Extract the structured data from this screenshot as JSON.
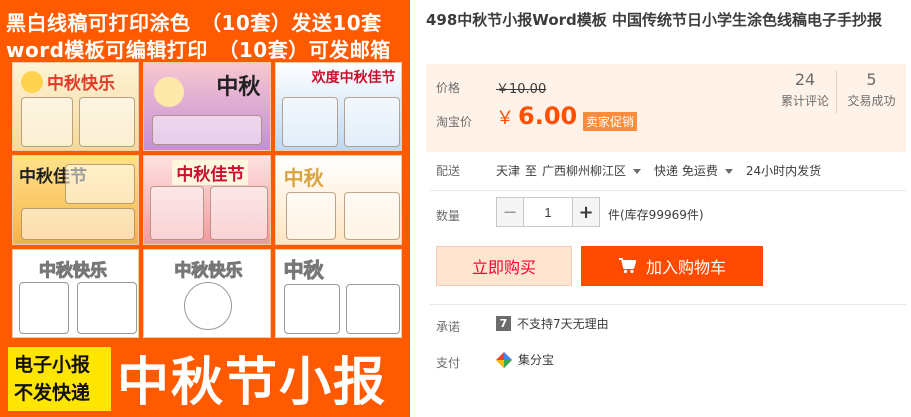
{
  "image": {
    "banner_line_1": "黑白线稿可打印涂色　（10套）发送10套",
    "banner_line_2": "word模板可编辑打印　（10套）可发邮箱",
    "badge_line_1": "电子小报",
    "badge_line_2": "不发快递",
    "big_title": "中秋节小报",
    "thumb_titles": [
      "中秋快乐",
      "中秋",
      "欢度中秋佳节",
      "中秋佳节",
      "中秋佳节",
      "中秋",
      "中秋快乐",
      "中秋快乐",
      "中秋"
    ],
    "brand_orange": "#ff5a00",
    "badge_yellow": "#ffe600"
  },
  "product": {
    "title": "498中秋节小报Word模板 中国传统节日小学生涂色线稿电子手抄报"
  },
  "price": {
    "label": "价格",
    "original": "￥10.00",
    "promo_label": "淘宝价",
    "currency": "￥",
    "promo_value": "6.00",
    "promo_badge": "卖家促销",
    "accent_color": "#ff5000"
  },
  "stats": {
    "reviews_count": "24",
    "reviews_label": "累计评论",
    "sales_count": "5",
    "sales_label": "交易成功"
  },
  "shipping": {
    "label": "配送",
    "from": "天津",
    "to_word": "至",
    "destination": "广西柳州柳江区",
    "method": "快递 免运费",
    "dispatch": "24小时内发货"
  },
  "quantity": {
    "label": "数量",
    "minus": "−",
    "value": "1",
    "plus": "+",
    "stock_text": "件(库存99969件)"
  },
  "actions": {
    "buy_now": "立即购买",
    "add_to_cart": "加入购物车",
    "cart_icon": "cart-icon"
  },
  "promise": {
    "label": "承诺",
    "icon_text": "7",
    "text": "不支持7天无理由"
  },
  "payment": {
    "label": "支付",
    "method": "集分宝",
    "icon": "jifenbao-icon"
  }
}
